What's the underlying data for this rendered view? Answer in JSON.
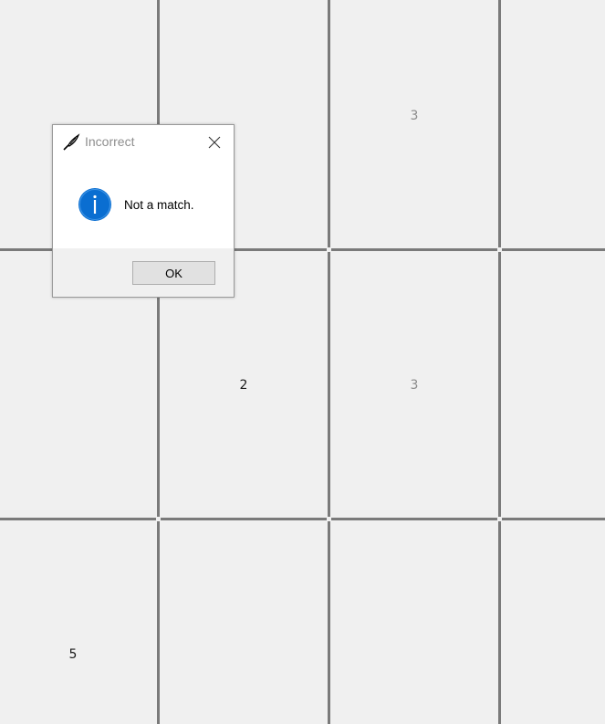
{
  "board": {
    "tiles": [
      {
        "row": 0,
        "col": 0,
        "label": ""
      },
      {
        "row": 0,
        "col": 1,
        "label": ""
      },
      {
        "row": 0,
        "col": 2,
        "label": "3",
        "style": "dim"
      },
      {
        "row": 0,
        "col": 3,
        "label": ""
      },
      {
        "row": 1,
        "col": 0,
        "label": ""
      },
      {
        "row": 1,
        "col": 1,
        "label": "2",
        "style": "dark"
      },
      {
        "row": 1,
        "col": 2,
        "label": "3",
        "style": "dim"
      },
      {
        "row": 1,
        "col": 3,
        "label": ""
      },
      {
        "row": 2,
        "col": 0,
        "label": "5",
        "style": "dark"
      },
      {
        "row": 2,
        "col": 1,
        "label": ""
      },
      {
        "row": 2,
        "col": 2,
        "label": ""
      },
      {
        "row": 2,
        "col": 3,
        "label": ""
      }
    ],
    "line_color": "#7a7a7a",
    "background": "#f0f0f0"
  },
  "dialog": {
    "title": "Incorrect",
    "app_icon": "quill-pen-icon",
    "close_icon": "close-icon",
    "message": "Not a match.",
    "message_icon": "info-icon",
    "info_color": "#0a6ed1",
    "ok_label": "OK"
  }
}
